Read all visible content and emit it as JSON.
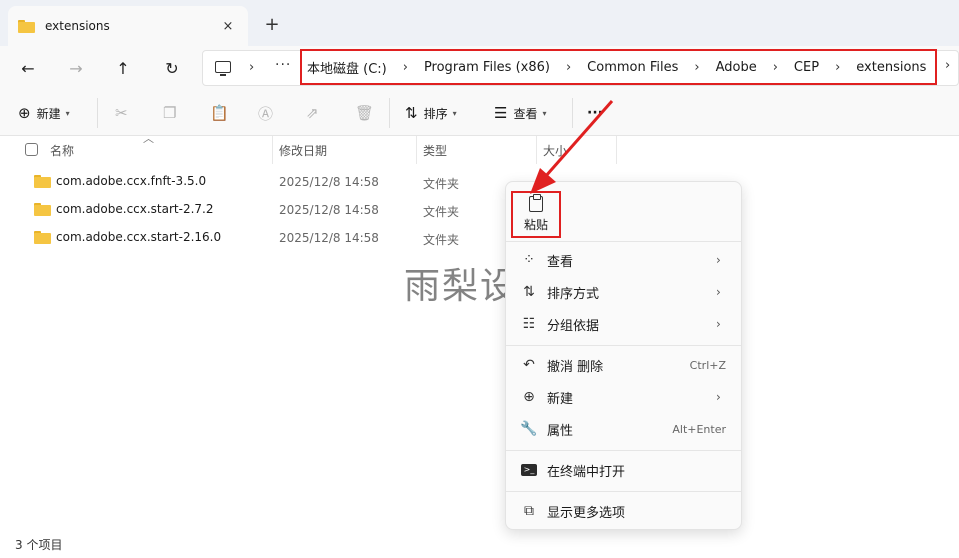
{
  "tab": {
    "title": "extensions",
    "close_icon": "×",
    "new_tab_icon": "+"
  },
  "nav": {
    "back": "←",
    "forward": "→",
    "up": "↑",
    "refresh": "↻",
    "more": "···"
  },
  "breadcrumbs": [
    "本地磁盘 (C:)",
    "Program Files (x86)",
    "Common Files",
    "Adobe",
    "CEP",
    "extensions"
  ],
  "toolbar": {
    "new_label": "新建",
    "sort_label": "排序",
    "view_label": "查看",
    "more": "···"
  },
  "columns": {
    "name": "名称",
    "date": "修改日期",
    "type": "类型",
    "size": "大小"
  },
  "files": [
    {
      "name": "com.adobe.ccx.fnft-3.5.0",
      "date": "2025/12/8 14:58",
      "type": "文件夹"
    },
    {
      "name": "com.adobe.ccx.start-2.7.2",
      "date": "2025/12/8 14:58",
      "type": "文件夹"
    },
    {
      "name": "com.adobe.ccx.start-2.16.0",
      "date": "2025/12/8 14:58",
      "type": "文件夹"
    }
  ],
  "context_menu": {
    "paste": "粘贴",
    "view": "查看",
    "sort_by": "排序方式",
    "group_by": "分组依据",
    "undo_delete": "撤消 删除",
    "undo_shortcut": "Ctrl+Z",
    "new": "新建",
    "properties": "属性",
    "properties_shortcut": "Alt+Enter",
    "open_terminal": "在终端中打开",
    "more_options": "显示更多选项"
  },
  "status": {
    "item_count": "3 个项目"
  },
  "watermark": "雨梨设计",
  "colors": {
    "highlight": "#e02020",
    "folder": "#f5c542"
  }
}
